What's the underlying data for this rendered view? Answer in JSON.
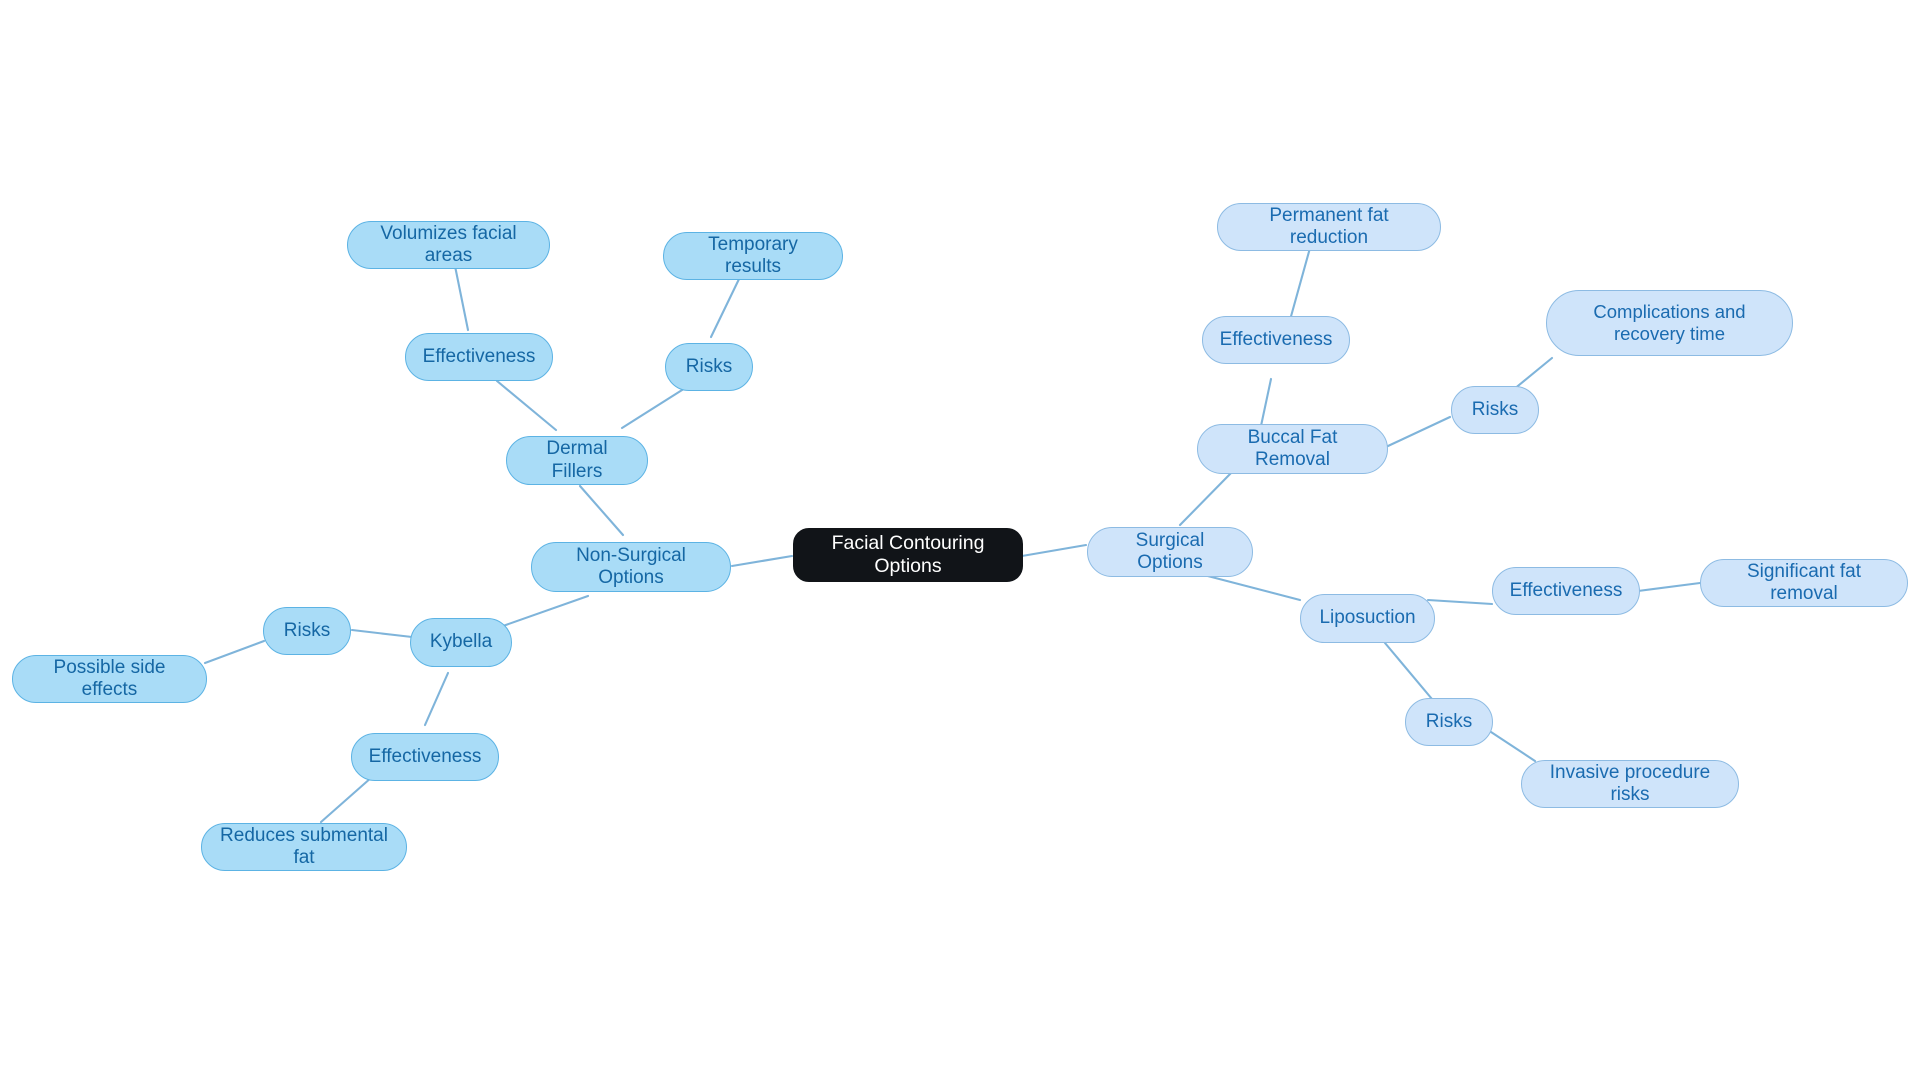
{
  "diagram": {
    "title": "Facial Contouring Options",
    "type": "mind-map",
    "background_color": "#ffffff",
    "edge_color": "#7fb4da",
    "palette": {
      "root_fill": "#111418",
      "root_text": "#ffffff",
      "left_fill": "#a9dcf7",
      "left_border": "#5cb3e4",
      "left_text": "#1567a4",
      "right_fill": "#cfe4fa",
      "right_border": "#8dbbe3",
      "right_text": "#1a6bb0"
    }
  },
  "nodes": {
    "root": {
      "label": "Facial Contouring Options"
    },
    "non_surgical": {
      "label": "Non-Surgical Options"
    },
    "surgical": {
      "label": "Surgical Options"
    },
    "dermal_fillers": {
      "label": "Dermal Fillers"
    },
    "dermal_effectiveness": {
      "label": "Effectiveness"
    },
    "dermal_effectiveness_detail": {
      "label": "Volumizes facial areas"
    },
    "dermal_risks": {
      "label": "Risks"
    },
    "dermal_risks_detail": {
      "label": "Temporary results"
    },
    "kybella": {
      "label": "Kybella"
    },
    "kybella_risks": {
      "label": "Risks"
    },
    "kybella_risks_detail": {
      "label": "Possible side effects"
    },
    "kybella_effectiveness": {
      "label": "Effectiveness"
    },
    "kybella_effectiveness_detail": {
      "label": "Reduces submental fat"
    },
    "buccal": {
      "label": "Buccal Fat Removal"
    },
    "buccal_effectiveness": {
      "label": "Effectiveness"
    },
    "buccal_effectiveness_detail": {
      "label": "Permanent fat reduction"
    },
    "buccal_risks": {
      "label": "Risks"
    },
    "buccal_risks_detail": {
      "label": "Complications and recovery time"
    },
    "liposuction": {
      "label": "Liposuction"
    },
    "lipo_effectiveness": {
      "label": "Effectiveness"
    },
    "lipo_effectiveness_detail": {
      "label": "Significant fat removal"
    },
    "lipo_risks": {
      "label": "Risks"
    },
    "lipo_risks_detail": {
      "label": "Invasive procedure risks"
    }
  },
  "chart_data": {
    "type": "diagram",
    "title": "Facial Contouring Options",
    "root": "Facial Contouring Options",
    "branches": [
      {
        "name": "Non-Surgical Options",
        "side": "left",
        "children": [
          {
            "name": "Dermal Fillers",
            "children": [
              {
                "name": "Effectiveness",
                "children": [
                  {
                    "name": "Volumizes facial areas"
                  }
                ]
              },
              {
                "name": "Risks",
                "children": [
                  {
                    "name": "Temporary results"
                  }
                ]
              }
            ]
          },
          {
            "name": "Kybella",
            "children": [
              {
                "name": "Risks",
                "children": [
                  {
                    "name": "Possible side effects"
                  }
                ]
              },
              {
                "name": "Effectiveness",
                "children": [
                  {
                    "name": "Reduces submental fat"
                  }
                ]
              }
            ]
          }
        ]
      },
      {
        "name": "Surgical Options",
        "side": "right",
        "children": [
          {
            "name": "Buccal Fat Removal",
            "children": [
              {
                "name": "Effectiveness",
                "children": [
                  {
                    "name": "Permanent fat reduction"
                  }
                ]
              },
              {
                "name": "Risks",
                "children": [
                  {
                    "name": "Complications and recovery time"
                  }
                ]
              }
            ]
          },
          {
            "name": "Liposuction",
            "children": [
              {
                "name": "Effectiveness",
                "children": [
                  {
                    "name": "Significant fat removal"
                  }
                ]
              },
              {
                "name": "Risks",
                "children": [
                  {
                    "name": "Invasive procedure risks"
                  }
                ]
              }
            ]
          }
        ]
      }
    ]
  }
}
